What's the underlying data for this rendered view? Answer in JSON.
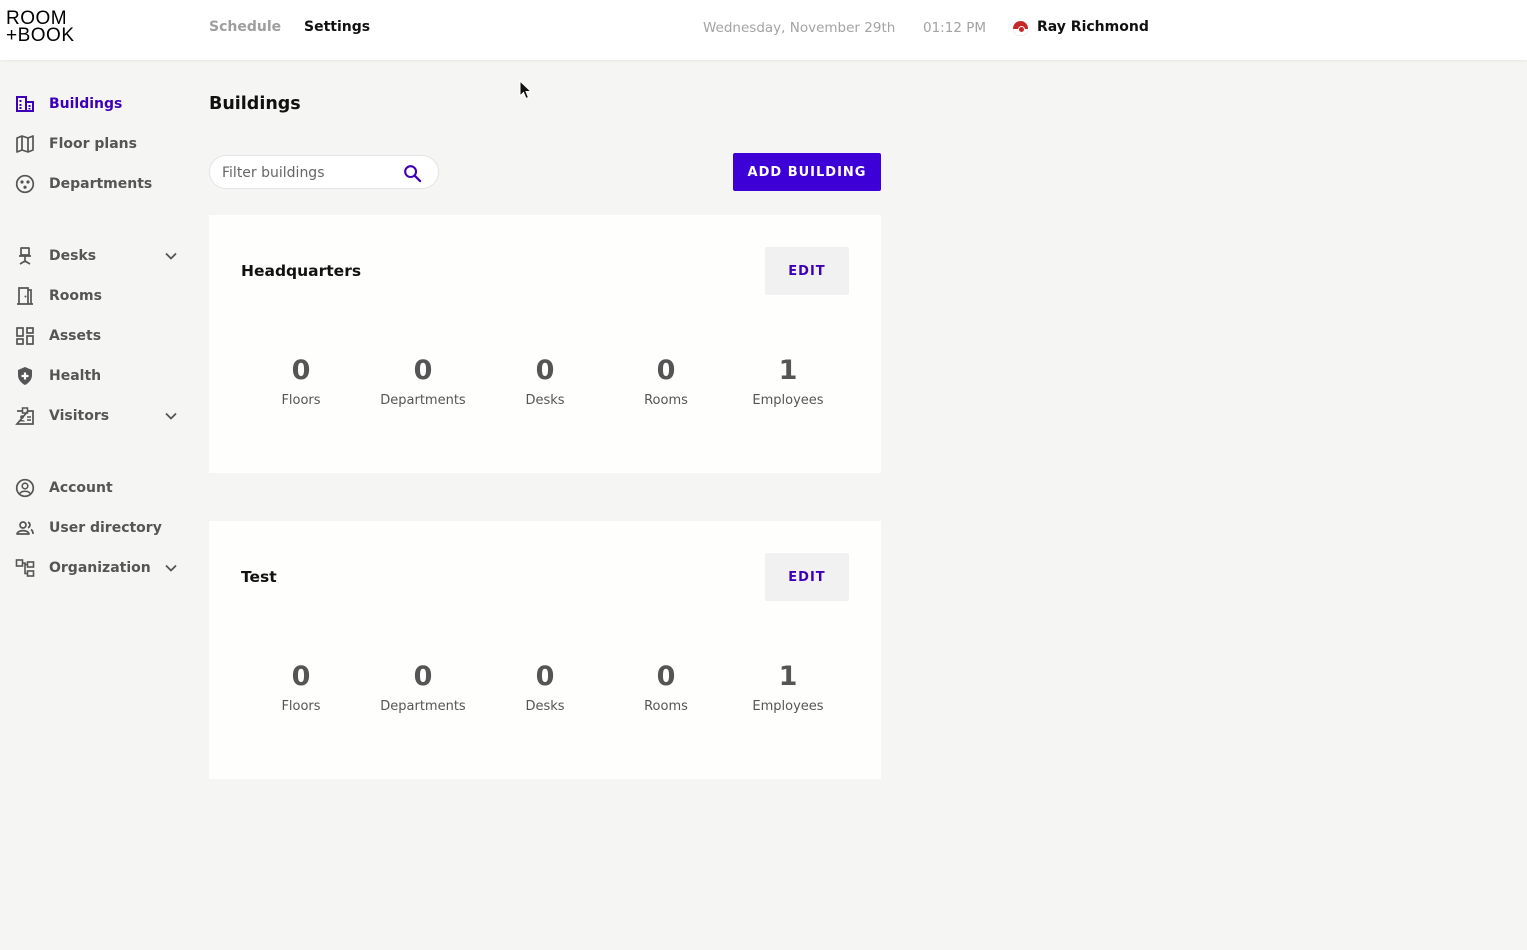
{
  "brand": {
    "logo_line1": "ROOM",
    "logo_line2": "+BOOK"
  },
  "topnav": {
    "schedule": "Schedule",
    "settings": "Settings",
    "date": "Wednesday, November 29th",
    "time": "01:12 PM",
    "user_name": "Ray Richmond"
  },
  "sidebar": {
    "items": [
      {
        "label": "Buildings",
        "icon": "building-icon",
        "active": true
      },
      {
        "label": "Floor plans",
        "icon": "map-icon"
      },
      {
        "label": "Departments",
        "icon": "departments-icon"
      },
      {
        "label": "Desks",
        "icon": "desk-chair-icon",
        "expandable": true
      },
      {
        "label": "Rooms",
        "icon": "door-icon"
      },
      {
        "label": "Assets",
        "icon": "assets-grid-icon"
      },
      {
        "label": "Health",
        "icon": "health-shield-icon"
      },
      {
        "label": "Visitors",
        "icon": "visitor-badge-icon",
        "expandable": true
      },
      {
        "label": "Account",
        "icon": "account-icon"
      },
      {
        "label": "User directory",
        "icon": "users-icon"
      },
      {
        "label": "Organization",
        "icon": "organization-icon",
        "expandable": true
      }
    ]
  },
  "main": {
    "title": "Buildings",
    "filter_placeholder": "Filter buildings",
    "add_button": "ADD BUILDING",
    "edit_label": "EDIT",
    "buildings": [
      {
        "name": "Headquarters",
        "stats": [
          {
            "value": "0",
            "label": "Floors"
          },
          {
            "value": "0",
            "label": "Departments"
          },
          {
            "value": "0",
            "label": "Desks"
          },
          {
            "value": "0",
            "label": "Rooms"
          },
          {
            "value": "1",
            "label": "Employees"
          }
        ]
      },
      {
        "name": "Test",
        "stats": [
          {
            "value": "0",
            "label": "Floors"
          },
          {
            "value": "0",
            "label": "Departments"
          },
          {
            "value": "0",
            "label": "Desks"
          },
          {
            "value": "0",
            "label": "Rooms"
          },
          {
            "value": "1",
            "label": "Employees"
          }
        ]
      }
    ]
  },
  "colors": {
    "accent": "#3d00d6",
    "active_text": "#3d00b8",
    "background": "#f5f5f3",
    "avatar_red": "#c62828"
  }
}
